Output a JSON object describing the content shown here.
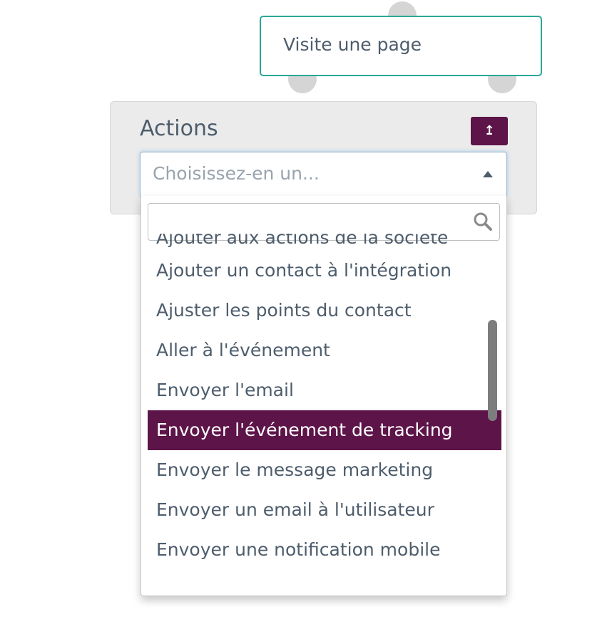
{
  "trigger": {
    "label": "Visite une page",
    "border_color": "#2aa79a"
  },
  "actions": {
    "title": "Actions",
    "button_icon": "arrow-up-icon",
    "button_glyph": "↥",
    "button_color": "#5d1449"
  },
  "select": {
    "placeholder": "Choisissez-en un..."
  },
  "dropdown": {
    "search_value": "",
    "search_icon": "search-icon",
    "options": [
      "Ajouter aux actions de la société",
      "Ajouter un contact à l'intégration",
      "Ajuster les points du contact",
      "Aller à l'événement",
      "Envoyer l'email",
      "Envoyer l'événement de tracking",
      "Envoyer le message marketing",
      "Envoyer un email à l'utilisateur",
      "Envoyer une notification mobile"
    ],
    "selected_option": "Envoyer l'événement de tracking",
    "highlight_color": "#5d1449"
  }
}
